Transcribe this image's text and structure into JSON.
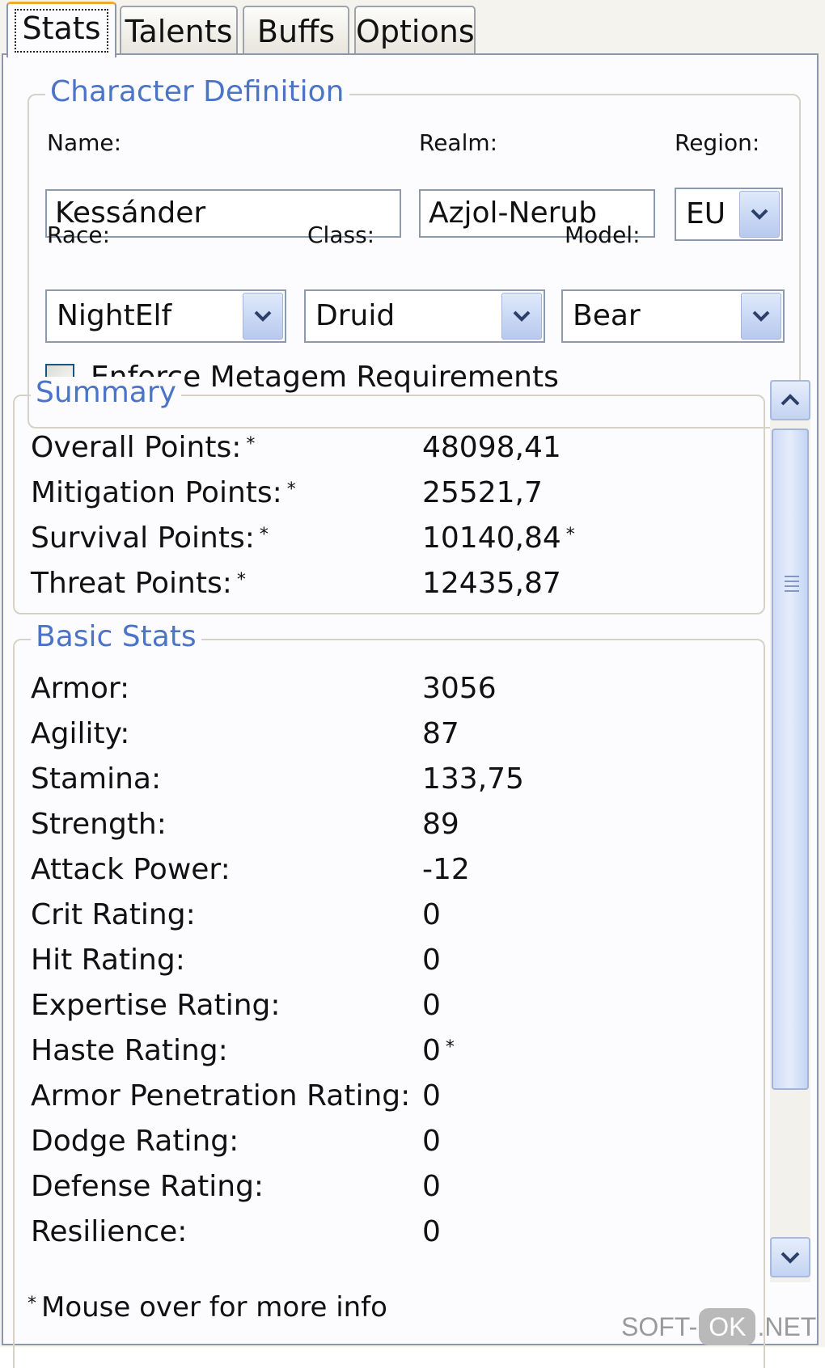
{
  "tabs": [
    {
      "label": "Stats",
      "active": true
    },
    {
      "label": "Talents",
      "active": false
    },
    {
      "label": "Buffs",
      "active": false
    },
    {
      "label": "Options",
      "active": false
    }
  ],
  "character_definition": {
    "title": "Character Definition",
    "name_label": "Name:",
    "name_value": "Kessánder",
    "realm_label": "Realm:",
    "realm_value": "Azjol-Nerub",
    "region_label": "Region:",
    "region_value": "EU",
    "race_label": "Race:",
    "race_value": "NightElf",
    "class_label": "Class:",
    "class_value": "Druid",
    "model_label": "Model:",
    "model_value": "Bear",
    "enforce_label": "Enforce Metagem Requirements",
    "enforce_checked": false
  },
  "summary": {
    "title": "Summary",
    "rows": [
      {
        "label": "Overall Points:",
        "value": "48098,41"
      },
      {
        "label": "Mitigation Points:",
        "value": "25521,7"
      },
      {
        "label": "Survival Points:",
        "value": "10140,84"
      },
      {
        "label": "Threat Points:",
        "value": "12435,87"
      }
    ]
  },
  "basic_stats": {
    "title": "Basic Stats",
    "rows": [
      {
        "label": "Armor:",
        "value": "3056"
      },
      {
        "label": "Agility:",
        "value": "87"
      },
      {
        "label": "Stamina:",
        "value": "133,75"
      },
      {
        "label": "Strength:",
        "value": "89"
      },
      {
        "label": "Attack Power:",
        "value": "-12"
      },
      {
        "label": "Crit Rating:",
        "value": "0"
      },
      {
        "label": "Hit Rating:",
        "value": "0"
      },
      {
        "label": "Expertise Rating:",
        "value": "0"
      },
      {
        "label": "Haste Rating:",
        "value": "0"
      },
      {
        "label": "Armor Penetration Rating:",
        "value": "0"
      },
      {
        "label": "Dodge Rating:",
        "value": "0"
      },
      {
        "label": "Defense Rating:",
        "value": "0"
      },
      {
        "label": "Resilience:",
        "value": "0"
      }
    ]
  },
  "marker_symbol": "*",
  "footer_text": "Mouse over for more info",
  "watermark": {
    "left": "SOFT-",
    "ok": "OK",
    "right": ".NET"
  },
  "colors": {
    "accent": "#4b74c9",
    "active_tab": "#f3a928"
  }
}
